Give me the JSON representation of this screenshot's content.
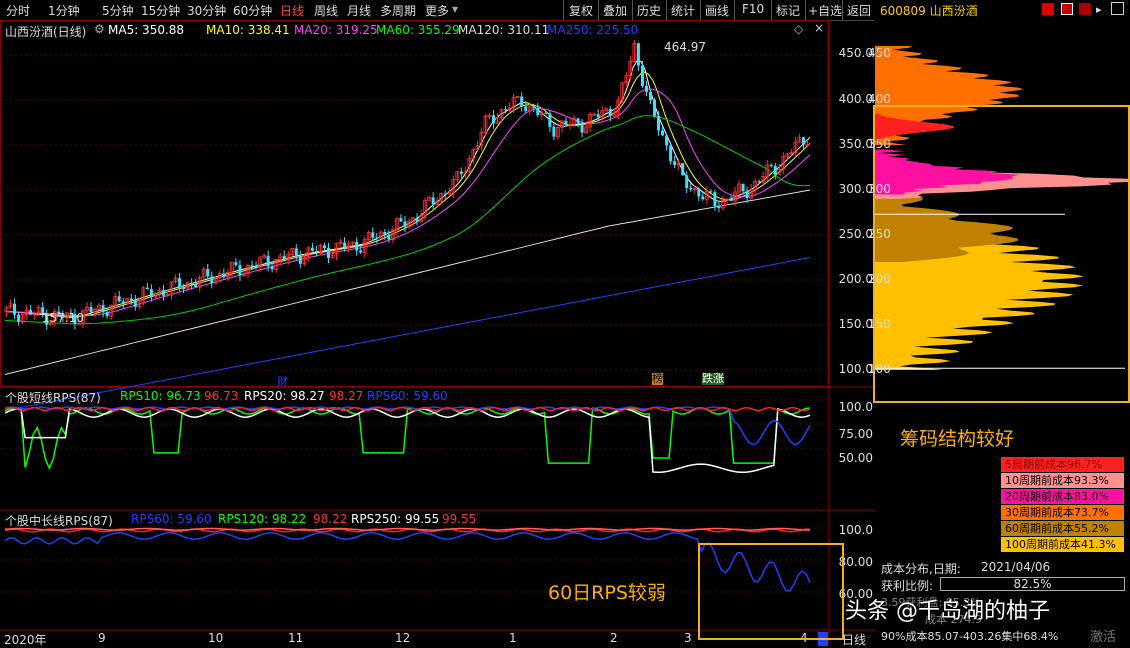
{
  "toolbar": {
    "periods": [
      "分时",
      "1分钟",
      "5分钟",
      "15分钟",
      "30分钟",
      "60分钟",
      "日线",
      "周线",
      "月线",
      "多周期",
      "更多"
    ],
    "active_period": "日线",
    "actions": [
      "复权",
      "叠加",
      "历史",
      "统计",
      "画线",
      "F10",
      "标记",
      "+自选",
      "返回"
    ]
  },
  "stock": {
    "code_name": "600809 山西汾酒",
    "title": "山西汾酒(日线)"
  },
  "ma_bar": {
    "items": [
      {
        "text": "MA5: 350.88",
        "color": "#ffffff"
      },
      {
        "text": "MA10: 338.41",
        "color": "#ffff00"
      },
      {
        "text": "MA20: 319.25",
        "color": "#ff40ff"
      },
      {
        "text": "MA60: 355.29",
        "color": "#00ff00"
      },
      {
        "text": "MA120: 310.11",
        "color": "#dddddd"
      },
      {
        "text": "MA250: 225.50",
        "color": "#2040ff"
      }
    ]
  },
  "price_axis": [
    "450.0",
    "400.0",
    "350.0",
    "300.0",
    "250.0",
    "200.0",
    "150.0",
    "100.0"
  ],
  "chip_axis": [
    "450",
    "400",
    "350",
    "300",
    "250",
    "200",
    "150",
    "100"
  ],
  "annotations": {
    "high": "464.97",
    "low": "157.10",
    "markers": [
      "财",
      "榜",
      "跌涨"
    ]
  },
  "rps_short": {
    "title": "个股短线RPS(87)",
    "rps10_label": "RPS10: 96.73",
    "rps10_val": "96.73",
    "rps20_label": "RPS20: 98.27",
    "rps20_val": "98.27",
    "rps60_label": "RPS60: 59.60",
    "axis": [
      "100.0",
      "75.00",
      "50.00"
    ]
  },
  "rps_long": {
    "title": "个股中长线RPS(87)",
    "rps60_label": "RPS60: 59.60",
    "rps120_label": "RPS120: 98.22",
    "rps120_val": "98.22",
    "rps250_label": "RPS250: 99.55",
    "rps250_val": "99.55",
    "axis": [
      "100.0",
      "80.00",
      "60.00"
    ]
  },
  "notes": {
    "chip_good": "筹码结构较好",
    "rps60_weak": "60日RPS较弱"
  },
  "chip_legend": [
    {
      "text": "5周期前成本96.7%",
      "bg": "#ff2020",
      "color": "#800000"
    },
    {
      "text": "10周期前成本93.3%",
      "bg": "#ff9090",
      "color": "#000000"
    },
    {
      "text": "20周期前成本83.0%",
      "bg": "#ff10a0",
      "color": "#000000"
    },
    {
      "text": "30周期前成本73.7%",
      "bg": "#ff7000",
      "color": "#000000"
    },
    {
      "text": "60周期前成本55.2%",
      "bg": "#c08000",
      "color": "#000000"
    },
    {
      "text": "100周期前成本41.3%",
      "bg": "#ffc000",
      "color": "#000000"
    }
  ],
  "chip_info": {
    "date_label": "成本分布,日期:",
    "date": "2021/04/06",
    "profit_label": "获利比例:",
    "profit_value": "82.5%",
    "avg_partial": "3.59获利盘: 85.3%",
    "avg_partial2": "成本 274.9",
    "concentration": "90%成本85.07-403.26集中68.4%"
  },
  "watermark": {
    "text": "头条 @千岛湖的柚子",
    "corner": "激活"
  },
  "dates": [
    "2020年",
    "9",
    "10",
    "11",
    "12",
    "1",
    "2",
    "3",
    "4"
  ],
  "bottom_tab": "日线"
}
